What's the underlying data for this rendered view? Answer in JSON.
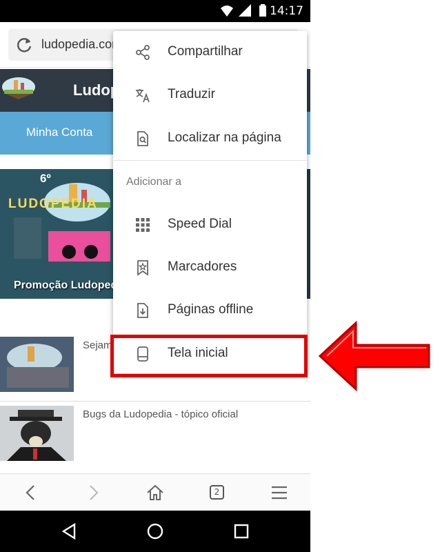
{
  "status_bar": {
    "time": "14:17"
  },
  "url_bar": {
    "url": "ludopedia.com"
  },
  "site": {
    "title": "Ludopedia",
    "nav_account": "Minha Conta",
    "banner_caption": "Promoção Ludopedia",
    "banner_edition": "6º",
    "banner_word": "LUDOPEDIA"
  },
  "list": [
    {
      "title": "Sejam"
    },
    {
      "title": "Bugs da Ludopedia - tópico oficial"
    }
  ],
  "toolbar": {
    "tabs_count": "2"
  },
  "menu": {
    "items_top": [
      {
        "label": "Compartilhar",
        "icon": "share-icon"
      },
      {
        "label": "Traduzir",
        "icon": "translate-icon"
      },
      {
        "label": "Localizar na página",
        "icon": "find-in-page-icon"
      }
    ],
    "section_label": "Adicionar a",
    "items_add": [
      {
        "label": "Speed Dial",
        "icon": "speed-dial-icon"
      },
      {
        "label": "Marcadores",
        "icon": "bookmark-icon"
      },
      {
        "label": "Páginas offline",
        "icon": "offline-page-icon"
      },
      {
        "label": "Tela inicial",
        "icon": "home-screen-icon"
      }
    ]
  },
  "annotation": {
    "highlight_color": "#e00000",
    "arrow_color": "#ff0000"
  }
}
